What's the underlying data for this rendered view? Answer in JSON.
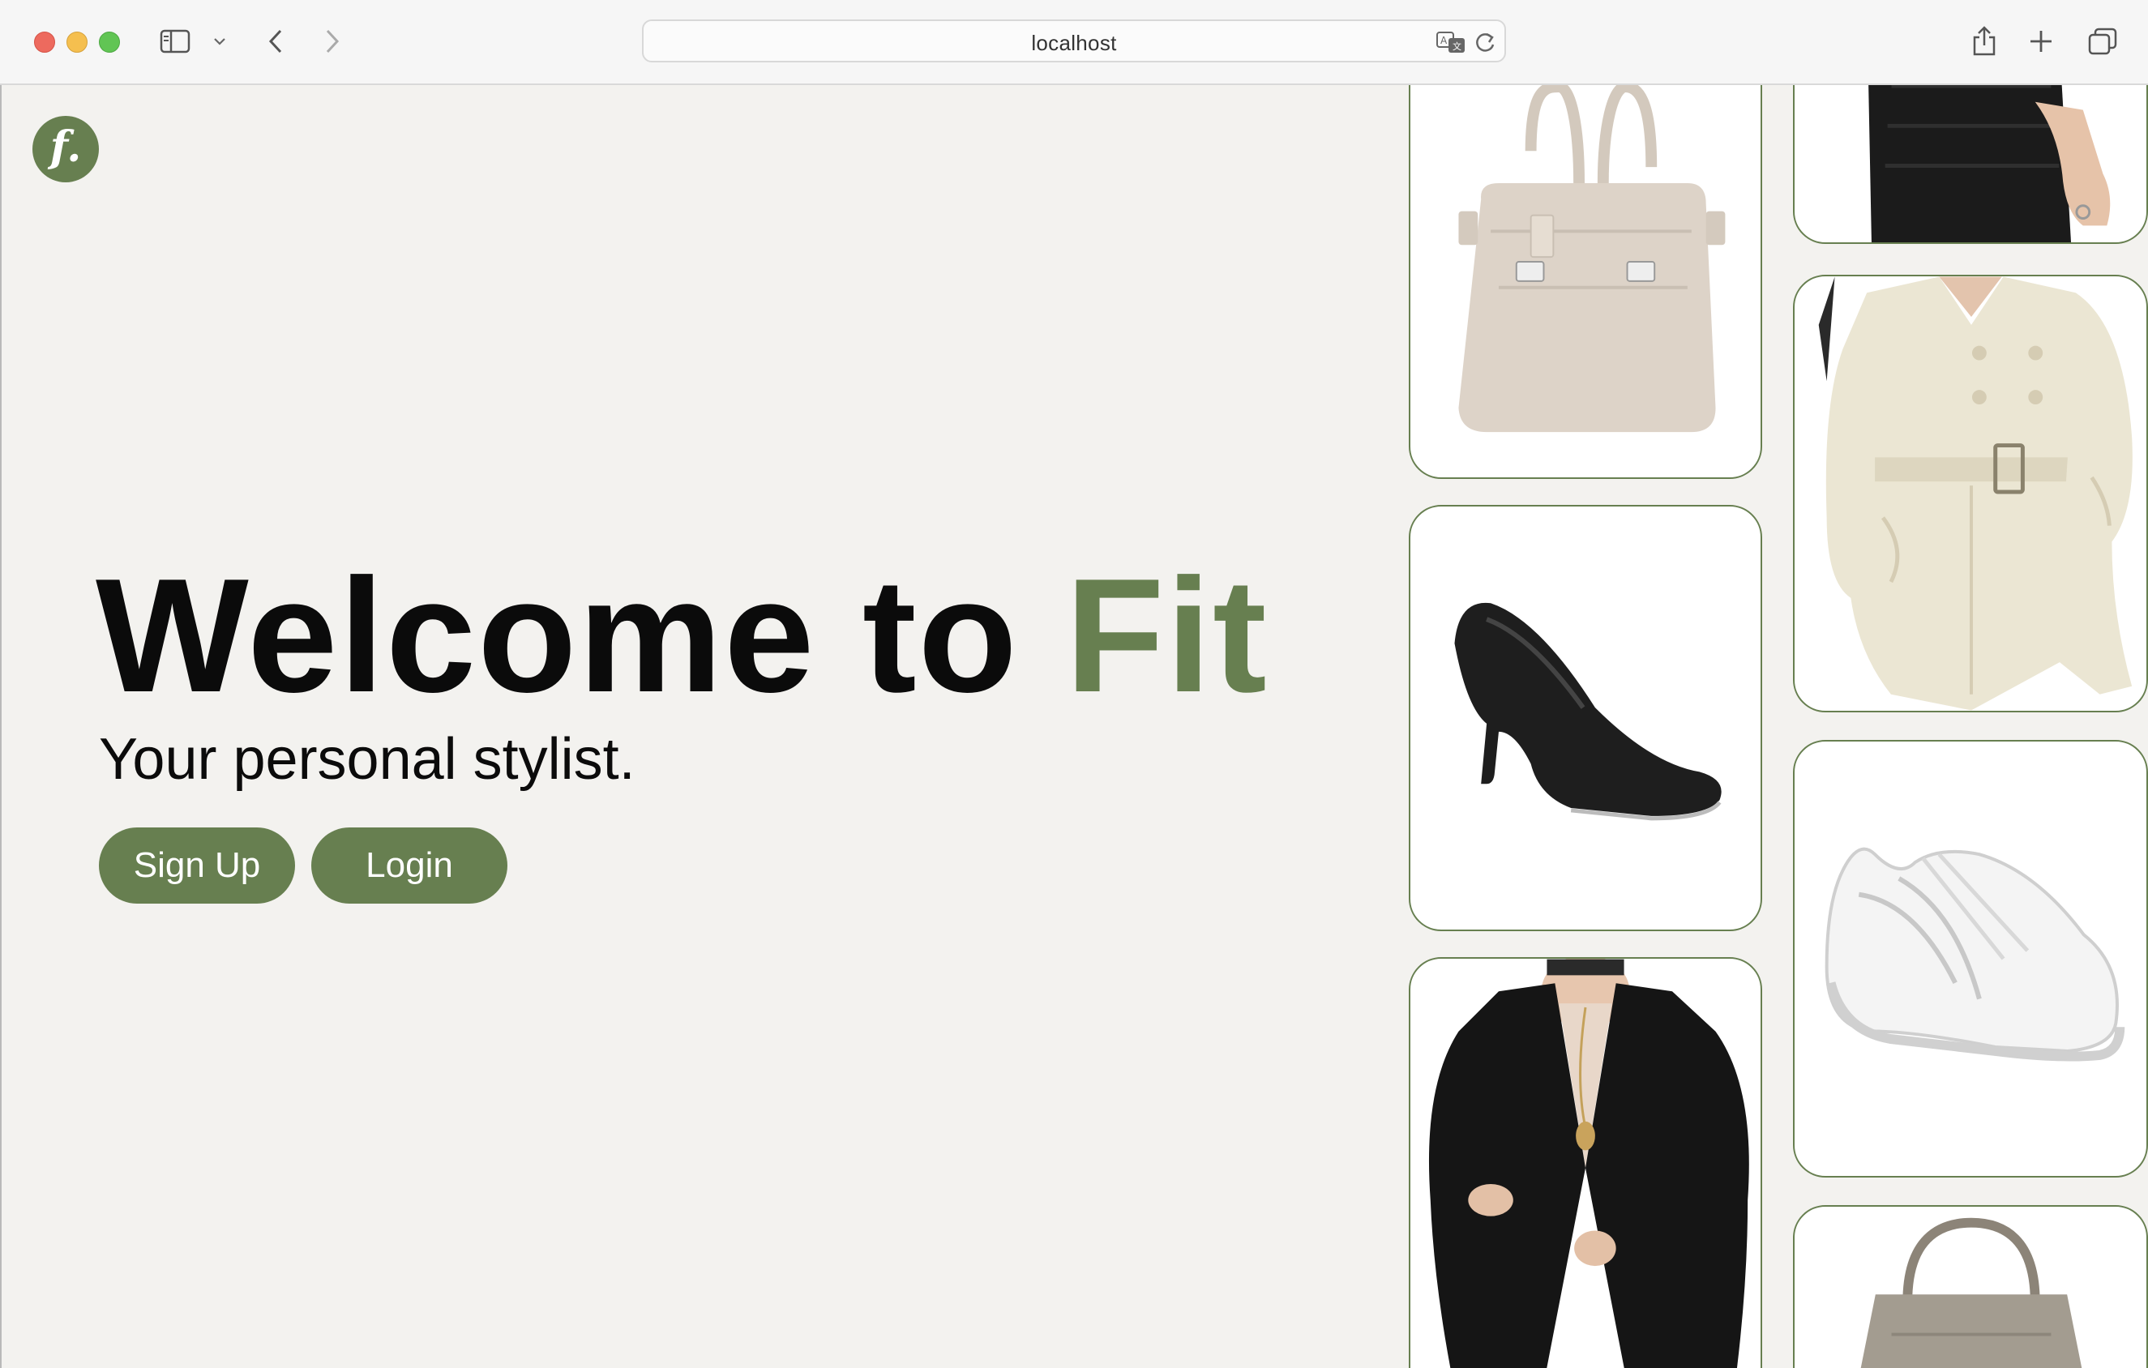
{
  "browser": {
    "url": "localhost"
  },
  "page": {
    "logo_text": "f.",
    "title_main": "Welcome to ",
    "title_accent": "Fit",
    "subtitle": "Your personal stylist.",
    "signup_label": "Sign Up",
    "login_label": "Login"
  },
  "colors": {
    "accent": "#677f50",
    "background": "#f3f2ef",
    "text": "#0b0b0b"
  },
  "products": [
    {
      "name": "beige-tote-bag-image",
      "icon": "handbag"
    },
    {
      "name": "black-pump-heel-image",
      "icon": "high-heel"
    },
    {
      "name": "black-blazer-image",
      "icon": "blazer"
    },
    {
      "name": "black-skirt-image",
      "icon": "skirt"
    },
    {
      "name": "beige-trench-coat-image",
      "icon": "trench-coat"
    },
    {
      "name": "white-sneaker-image",
      "icon": "sneaker"
    },
    {
      "name": "taupe-handbag-image",
      "icon": "handbag"
    }
  ]
}
